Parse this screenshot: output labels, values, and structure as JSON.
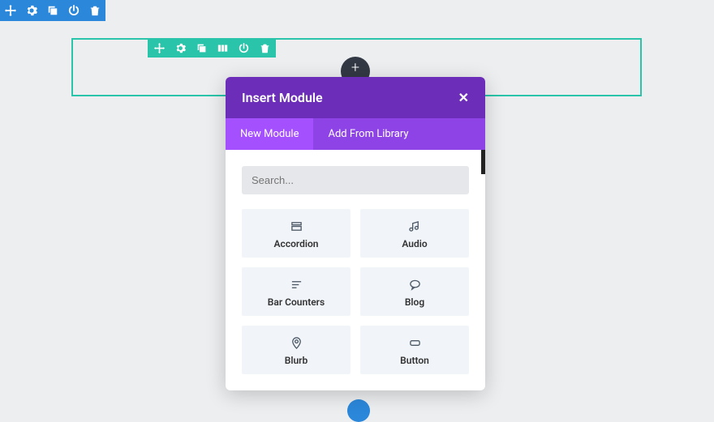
{
  "section_toolbar": [
    "move",
    "gear",
    "duplicate",
    "power",
    "trash"
  ],
  "row_toolbar": [
    "move",
    "gear",
    "duplicate",
    "columns",
    "power",
    "trash"
  ],
  "modal": {
    "title": "Insert Module",
    "tabs": [
      {
        "label": "New Module",
        "active": true
      },
      {
        "label": "Add From Library",
        "active": false
      }
    ],
    "search_placeholder": "Search...",
    "modules": [
      {
        "icon": "accordion",
        "label": "Accordion"
      },
      {
        "icon": "audio",
        "label": "Audio"
      },
      {
        "icon": "bars",
        "label": "Bar Counters"
      },
      {
        "icon": "chat",
        "label": "Blog"
      },
      {
        "icon": "pin",
        "label": "Blurb"
      },
      {
        "icon": "button",
        "label": "Button"
      }
    ]
  }
}
